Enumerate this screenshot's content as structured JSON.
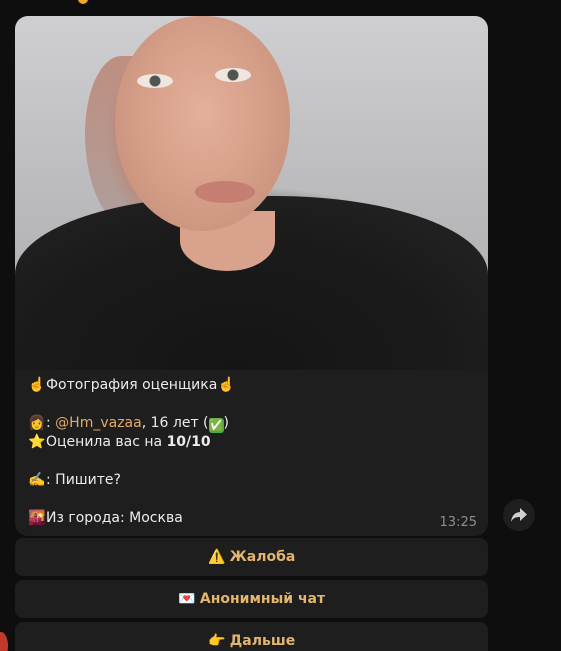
{
  "message": {
    "caption": {
      "line1_emoji_left": "☝️",
      "line1_text": "Фотография оценщика",
      "line1_emoji_right": "☝️",
      "person_emoji": "👩",
      "colon": ": ",
      "username": "@Hm_vazaa",
      "age_text": ", 16 лет (",
      "verified_icon": "✅",
      "age_close": ")",
      "star_emoji": "⭐",
      "rated_text": "Оценила вас на ",
      "rating": "10/10",
      "write_emoji": "✍️",
      "write_text": ": Пишите?",
      "city_emoji": "🌇",
      "city_text": "Из города: Москва"
    },
    "time": "13:25"
  },
  "keyboard": [
    {
      "emoji": "⚠️",
      "label": "Жалоба"
    },
    {
      "emoji": "💌",
      "label": "Анонимный чат"
    },
    {
      "emoji": "👉",
      "label": "Дальше"
    }
  ],
  "icons": {
    "forward": "share-arrow-icon"
  },
  "colors": {
    "background": "#0e0e0e",
    "bubble": "#1e1e1e",
    "link": "#e5a96a",
    "button_text": "#e3b56f",
    "time": "#8a8f94"
  }
}
